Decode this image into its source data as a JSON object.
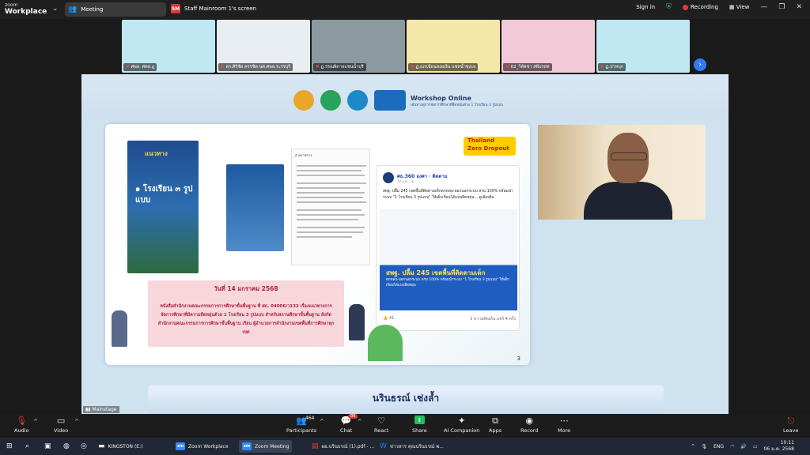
{
  "topbar": {
    "logo_line1": "zoom",
    "logo_line2": "Workplace",
    "meeting_tab": "Meeting",
    "share_badge": "SM",
    "share_title": "Staff Mainroom 1's screen",
    "signin": "Sign in",
    "recording": "Recording",
    "view": "View"
  },
  "thumbnails": [
    {
      "name": "ศพล. ศตส.ฎ",
      "bg": "#bfe8f3"
    },
    {
      "name": "ดร.ศิริชัย ครรชิต นศ.ศพล.ระรรบุรี",
      "bg": "#e9eef3"
    },
    {
      "name": "ฏ.รรณพิกาจแชนน้ำบุรี",
      "bg": "#8a9aa0"
    },
    {
      "name": "ฏ.ณรเฉียนสงยเงีน แชทน้ำชุงบง",
      "bg": "#f4e7a8"
    },
    {
      "name": "02_วิลัคชา สพีบรลท",
      "bg": "#f2c9d6"
    },
    {
      "name": "ฏ.ปาทบุก",
      "bg": "#bfe8f3"
    }
  ],
  "slide": {
    "header_title": "Workshop Online",
    "header_sub": "เส้นทางสู่การจัดการศึกษาที่ยืดหยุ่นด้วย 1 โรงเรียน 3 รูปแบบ",
    "book_title_small": "แนวทาง",
    "book_title_big": "๑ โรงเรียน ๓ รูปแบบ",
    "letter_head": "ส่วนราชการ",
    "fb_account": "ศธ.360 องศา · ติดตาม",
    "fb_account_sub": "10 ม.ค. · ⊕",
    "fb_post": "สพฐ. ปลื้ม 245 เขตพื้นที่ติดตามเด็กตกหล่น-ออกนอกระบบ ครบ 100% พร้อมนำระบบ \"1 โรงเรียน 3 รูปแบบ\" ให้เด็กเรียนได้แบบยืดหยุ่น... ดูเพิ่มเติม",
    "fb_caption1": "สพฐ. ปลื้ม 245 เขตพื้นที่ติดตามเด็ก",
    "fb_caption2": "ตกหล่น-ออกนอกระบบ ครบ 100% พร้อมนำระบบ \"1 โรงเรียน 3 รูปแบบ\" ให้เด็กเรียนได้แบบยืดหยุ่น",
    "fb_likes": "41",
    "fb_stats": "3 ความคิดเห็น  แชร์ 4 ครั้ง",
    "tz_line1": "Thailand",
    "tz_line2": "Zero Dropout",
    "date": "วันที่ 14 มกราคม 2568",
    "doc_text": "หนังสือสำนักงานคณะกรรมการการศึกษาขั้นพื้นฐาน ที่ ศธ. 04006/ว132 เรื่องแนวทางการจัดการศึกษาที่มีความยืดหยุ่นด้วย 1 โรงเรียน 3 รูปแบบ สำหรับสถานศึกษาขั้นพื้นฐาน สังกัดสำนักงานคณะกรรมการการศึกษาขั้นพื้นฐาน เรียน ผู้อำนวยการสำนักงานเขตพื้นที่การศึกษาทุกเขต",
    "page_number": "3"
  },
  "name_banner": "นรินธรณ์ เช่งล้ำ",
  "mainstage": "Mainstage",
  "controls": {
    "audio": "Audio",
    "video": "Video",
    "participants": "Participants",
    "participants_count": "464",
    "chat": "Chat",
    "chat_badge": "99",
    "react": "React",
    "share": "Share",
    "ai": "AI Companion",
    "apps": "Apps",
    "record": "Record",
    "more": "More",
    "leave": "Leave"
  },
  "taskbar": {
    "kingston": "KINGSTON (E:)",
    "zoom_workplace": "Zoom Workplace",
    "zoom_meeting": "Zoom Meeting",
    "pdf": "ผอ.นรินธรณ์ (1).pdf - ...",
    "word": "ข่าวสาร คุณนรินธรณ์ พ...",
    "lang": "ENG",
    "time": "10:11",
    "date": "06 ม.ค. 2568"
  },
  "colors": {
    "accent": "#2d8cff",
    "record": "#e53935",
    "share": "#1fbf5a",
    "shield": "#2ec04a"
  }
}
